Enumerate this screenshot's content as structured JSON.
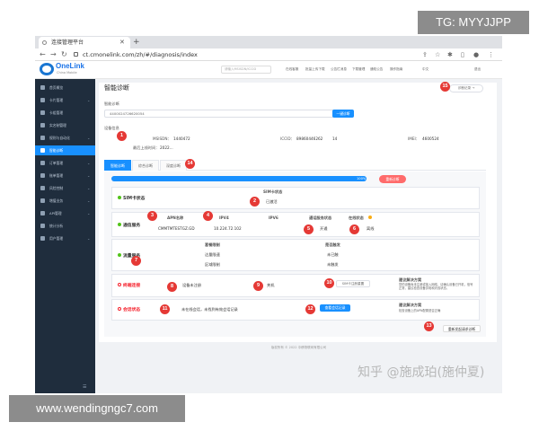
{
  "overlay": {
    "watermark_tr": "TG: MYYJJPP",
    "watermark_bl": "www.wendingngc7.com",
    "watermark_zh": "知乎 @施成珀(施仲夏)"
  },
  "browser": {
    "tab_title": "连接管理平台",
    "url": "ct.cmonelink.com/zh/#/diagnosis/index"
  },
  "app": {
    "brand": "OneLink",
    "brand_sub": "China Mobile",
    "search_placeholder": "请输入MSISDN/ICCID",
    "header_links": [
      "在线客服",
      "批量上传下载",
      "公告栏消息",
      "下载管理",
      "通知公告",
      "操作指南",
      "中文",
      "退出"
    ]
  },
  "sidebar": {
    "items": [
      {
        "label": "首页概览",
        "active": false,
        "chevron": false
      },
      {
        "label": "卡片管理",
        "active": false,
        "chevron": true
      },
      {
        "label": "卡组管理",
        "active": false,
        "chevron": false
      },
      {
        "label": "实名制管理",
        "active": false,
        "chevron": false
      },
      {
        "label": "规则与自动化",
        "active": false,
        "chevron": true
      },
      {
        "label": "智能诊断",
        "active": true,
        "chevron": false
      },
      {
        "label": "订单管理",
        "active": false,
        "chevron": true
      },
      {
        "label": "账单管理",
        "active": false,
        "chevron": true
      },
      {
        "label": "风险控制",
        "active": false,
        "chevron": true
      },
      {
        "label": "增值业务",
        "active": false,
        "chevron": true
      },
      {
        "label": "API管理",
        "active": false,
        "chevron": true
      },
      {
        "label": "统计分析",
        "active": false,
        "chevron": false
      },
      {
        "label": "用户管理",
        "active": false,
        "chevron": true
      }
    ],
    "collapse_glyph": "☰"
  },
  "main": {
    "title": "智能诊断",
    "top_button": "诊断记录",
    "search_label": "智能诊断",
    "search_value": "4400024726620054",
    "search_button": "一键诊断",
    "device_info_label": "设备信息",
    "fields": {
      "msisdn_label": "MSISDN：",
      "msisdn_value": "1440472",
      "iccid_label": "ICCID：",
      "iccid_value": "89860446262",
      "imei_label": "IMEI：",
      "imei_value": "4600524",
      "extra_value": "14",
      "activate_label": "最后上线时间：",
      "activate_value": "2022..."
    },
    "tabs": [
      "智能诊断",
      "综合诊断",
      "深度诊断"
    ],
    "progress": {
      "percent": 100,
      "text": "100%"
    },
    "rediagnose_button": "重新诊断",
    "sim_section": {
      "title": "SIM卡状态",
      "col_label": "SIM卡状态",
      "value": "已激活"
    },
    "network_section": {
      "title": "通信服务",
      "headers": [
        "APN名称",
        "IPV4",
        "IPV6",
        "通话服务状态",
        "在线状态"
      ],
      "values": [
        "CMMTMTESTGZ.GD",
        "10.224.72.102",
        "",
        "开通",
        "离线"
      ]
    },
    "flow_section": {
      "title": "流量服务",
      "headers": [
        "套餐限制",
        "是否触发"
      ],
      "rows": [
        [
          "达量限速",
          "未已触"
        ],
        [
          "区域限制",
          "未触发"
        ]
      ]
    },
    "device_section": {
      "title": "终端连接",
      "status": "设备未注册",
      "power": "关机",
      "button": "SIM卡注册重置",
      "suggest_title": "建议解决方案",
      "suggest_text": "您的设备尚未注册或接入网络，请确认设备已开机，信号正常，建议检查设备供电和天线状态。"
    },
    "session_section": {
      "title": "会话状态",
      "status": "未在线会话，未找到有效会话记录",
      "button": "查看会话记录",
      "suggest_title": "建议解决方案",
      "suggest_text": "检查设备上的APN配置是否正确"
    },
    "bottom_button": "重新发起请求诊断",
    "footer": "版权所有 © 2022 中移物联网有限公司"
  },
  "badges": [
    "1",
    "2",
    "3",
    "4",
    "5",
    "6",
    "7",
    "8",
    "9",
    "10",
    "11",
    "12",
    "13",
    "14",
    "15"
  ],
  "colors": {
    "primary": "#1890ff",
    "sidebar": "#1f2d3d",
    "badge": "#e53935",
    "danger": "#ff6b6b",
    "success": "#52c41a"
  }
}
